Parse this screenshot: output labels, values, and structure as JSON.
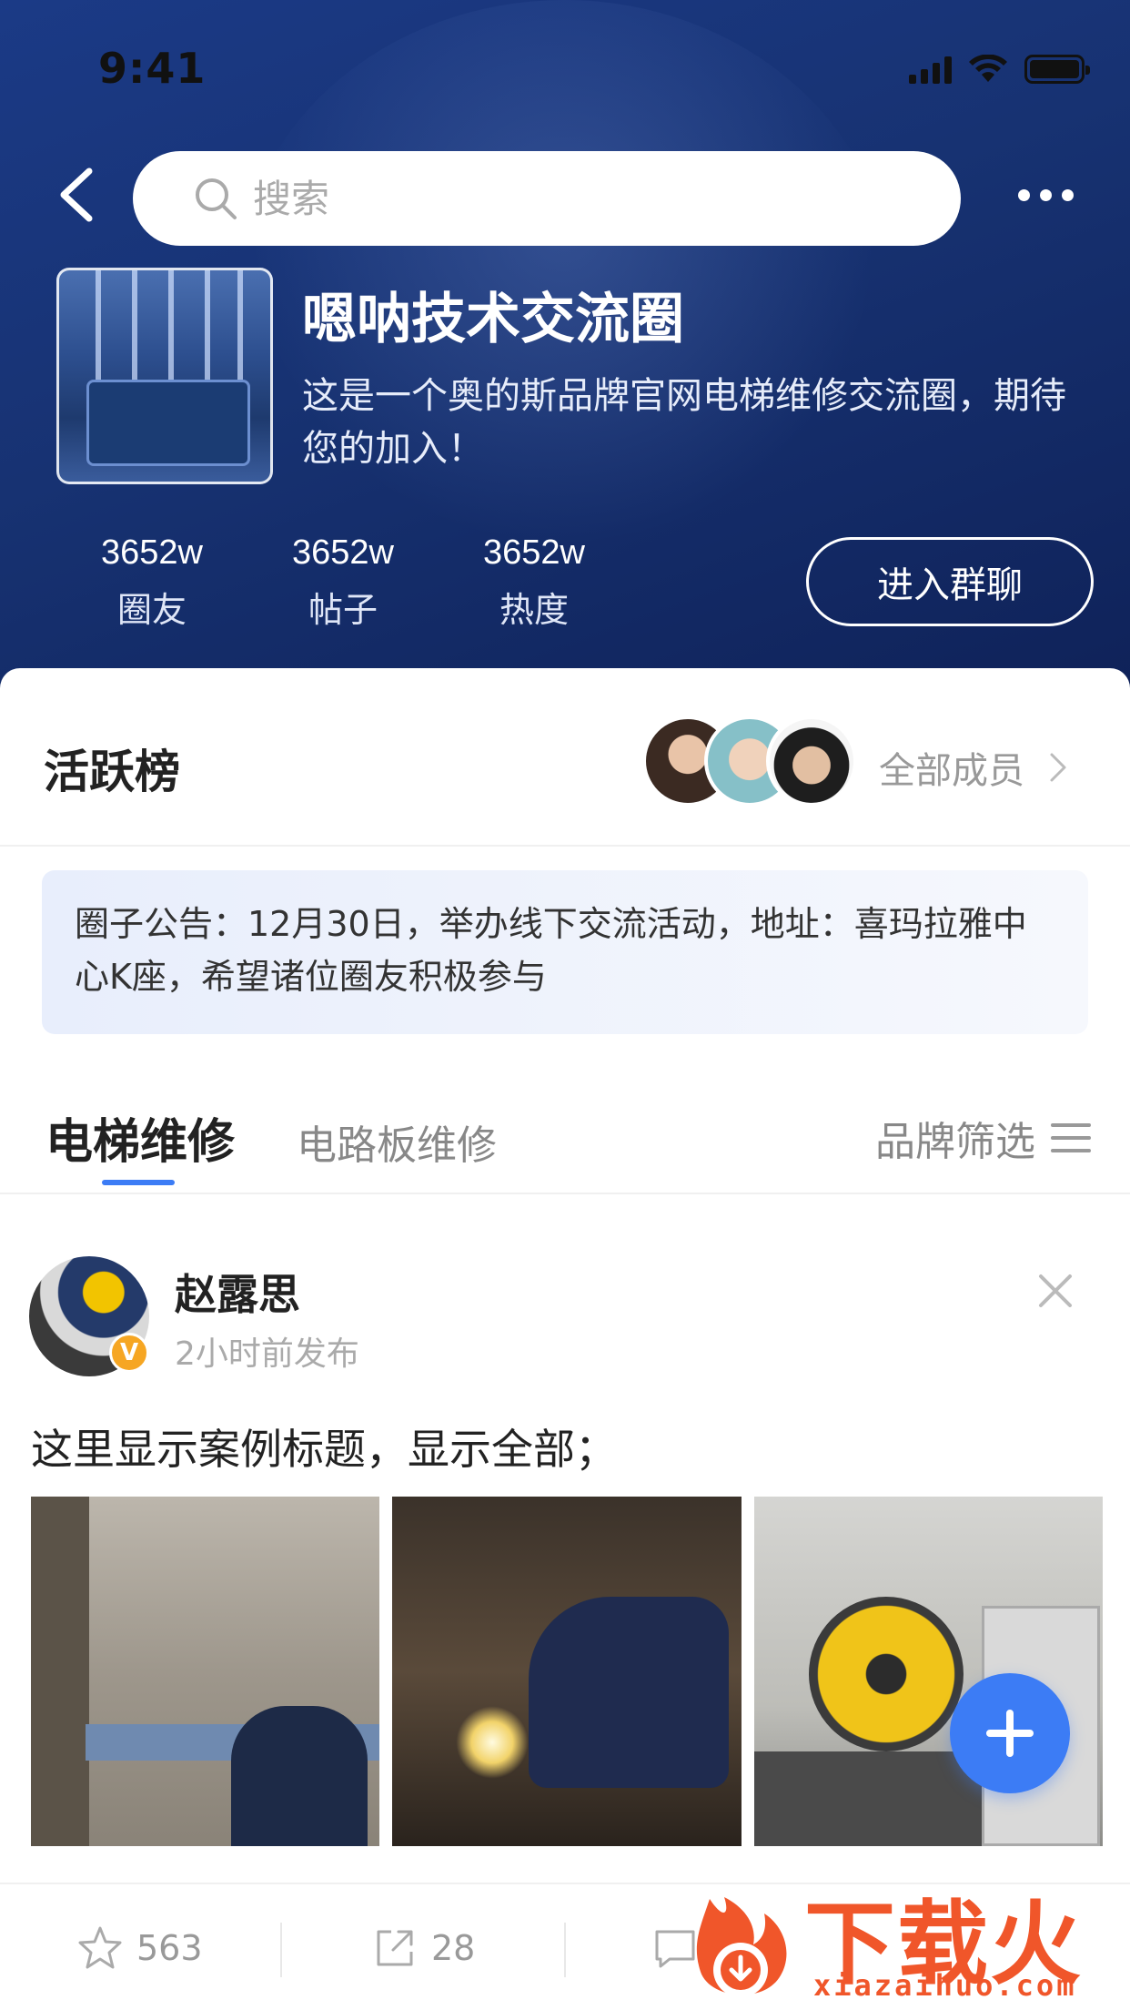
{
  "status_bar": {
    "time": "9:41"
  },
  "search": {
    "placeholder": "搜索"
  },
  "group": {
    "title": "嗯呐技术交流圈",
    "description": "这是一个奥的斯品牌官网电梯维修交流圈，期待您的加入！"
  },
  "stats": [
    {
      "value": "3652w",
      "label": "圈友"
    },
    {
      "value": "3652w",
      "label": "帖子"
    },
    {
      "value": "3652w",
      "label": "热度"
    }
  ],
  "join_button": "进入群聊",
  "active_board": {
    "title": "活跃榜",
    "all_members": "全部成员"
  },
  "notice": "圈子公告：12月30日，举办线下交流活动，地址：喜玛拉雅中心K座，希望诸位圈友积极参与",
  "tabs": [
    {
      "label": "电梯维修",
      "active": true
    },
    {
      "label": "电路板维修",
      "active": false
    }
  ],
  "brand_filter": "品牌筛选",
  "post": {
    "author": "赵露思",
    "verified_badge": "V",
    "time": "2小时前发布",
    "title": "这里显示案例标题，显示全部；"
  },
  "actions": {
    "favorites": "563",
    "shares": "28"
  },
  "watermark": {
    "text": "下载火",
    "url": "xiazaihuo.com"
  },
  "colors": {
    "accent": "#3c7cf5",
    "header_bg": "#173272",
    "watermark": "#f0562a",
    "badge": "#f6a623"
  }
}
